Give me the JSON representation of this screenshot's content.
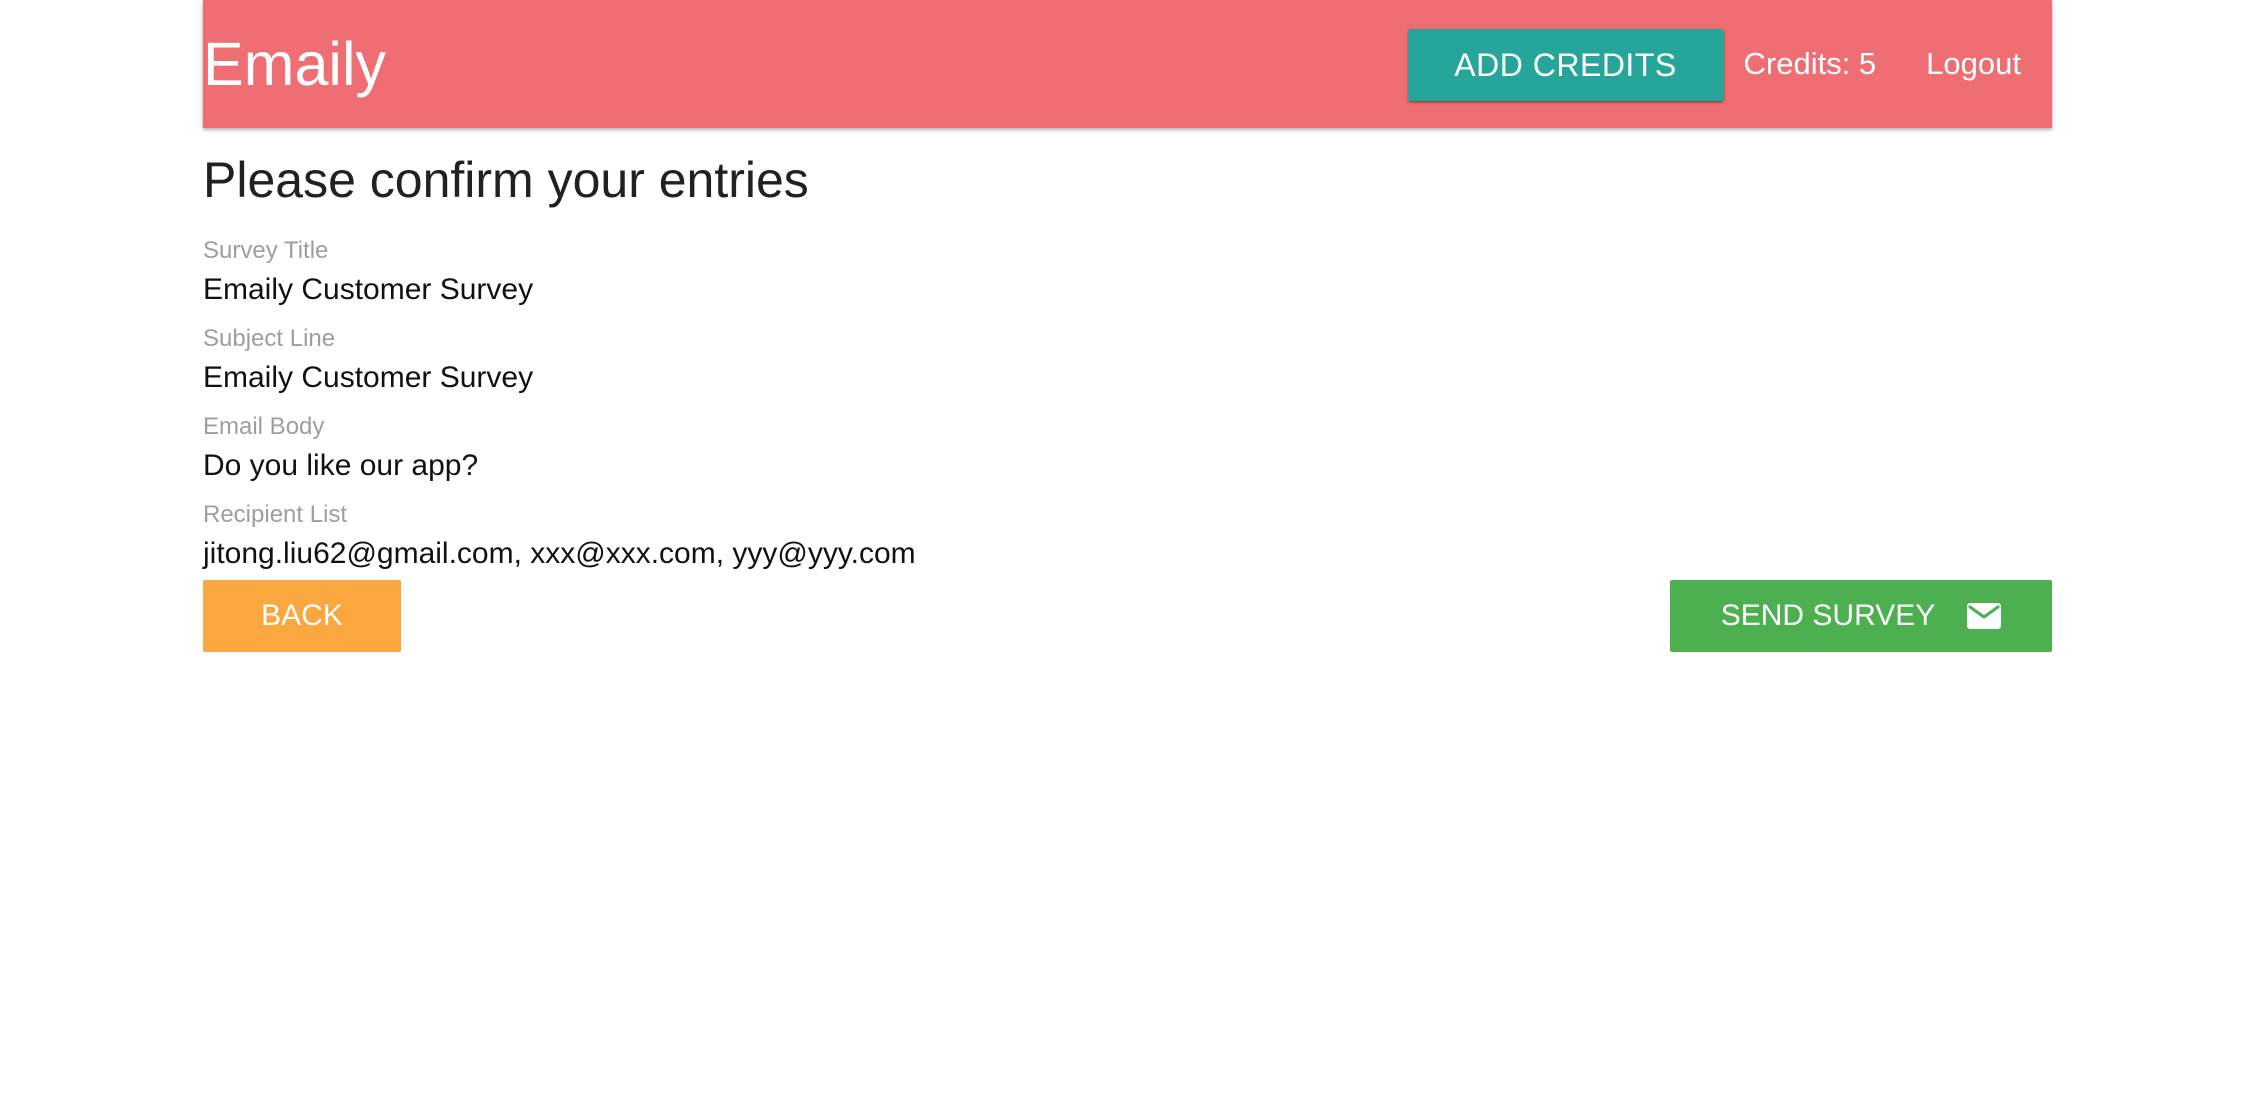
{
  "header": {
    "brand": "Emaily",
    "add_credits_label": "ADD CREDITS",
    "credits_text": "Credits: 5",
    "logout_label": "Logout",
    "bar_color": "#ee6e73",
    "add_credits_color": "#26a69a"
  },
  "main": {
    "title": "Please confirm your entries",
    "fields": [
      {
        "label": "Survey Title",
        "value": "Emaily Customer Survey"
      },
      {
        "label": "Subject Line",
        "value": "Emaily Customer Survey"
      },
      {
        "label": "Email Body",
        "value": "Do you like our app?"
      },
      {
        "label": "Recipient List",
        "value": "jitong.liu62@gmail.com, xxx@xxx.com, yyy@yyy.com"
      }
    ]
  },
  "actions": {
    "back_label": "BACK",
    "back_color": "#f9a73e",
    "send_label": "SEND SURVEY",
    "send_color": "#4caf50",
    "send_icon": "email-icon"
  }
}
